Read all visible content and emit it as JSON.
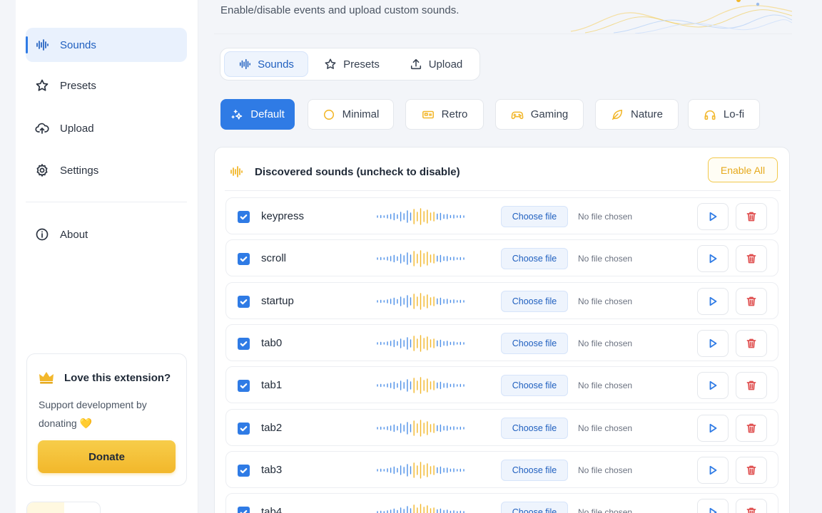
{
  "header": {
    "description": "Enable/disable events and upload custom sounds."
  },
  "sidebar": {
    "items": [
      {
        "label": "Sounds",
        "icon": "sound-wave-icon",
        "active": true
      },
      {
        "label": "Presets",
        "icon": "star-icon"
      },
      {
        "label": "Upload",
        "icon": "cloud-upload-icon"
      },
      {
        "label": "Settings",
        "icon": "gear-icon"
      },
      {
        "label": "About",
        "icon": "info-icon"
      }
    ],
    "donate": {
      "title": "Love this extension?",
      "text": "Support development by donating",
      "heart": "💛",
      "button": "Donate"
    }
  },
  "tabs": [
    {
      "label": "Sounds",
      "icon": "sound-wave-icon",
      "active": true
    },
    {
      "label": "Presets",
      "icon": "star-icon"
    },
    {
      "label": "Upload",
      "icon": "upload-icon"
    }
  ],
  "presets": [
    {
      "label": "Default",
      "icon": "sparkles-icon",
      "active": true
    },
    {
      "label": "Minimal",
      "icon": "circle-icon"
    },
    {
      "label": "Retro",
      "icon": "retro-icon"
    },
    {
      "label": "Gaming",
      "icon": "gamepad-icon"
    },
    {
      "label": "Nature",
      "icon": "leaf-icon"
    },
    {
      "label": "Lo-fi",
      "icon": "headphones-icon"
    }
  ],
  "panel": {
    "title": "Discovered sounds (uncheck to disable)",
    "enable_all": "Enable All"
  },
  "sounds": [
    {
      "name": "keypress",
      "checked": true
    },
    {
      "name": "scroll",
      "checked": true
    },
    {
      "name": "startup",
      "checked": true
    },
    {
      "name": "tab0",
      "checked": true
    },
    {
      "name": "tab1",
      "checked": true
    },
    {
      "name": "tab2",
      "checked": true
    },
    {
      "name": "tab3",
      "checked": true
    },
    {
      "name": "tab4",
      "checked": true
    }
  ],
  "row_labels": {
    "choose_file": "Choose file",
    "no_file": "No file chosen"
  },
  "colors": {
    "accent": "#2f7be5",
    "gold": "#f2b72b",
    "danger": "#e05252"
  }
}
